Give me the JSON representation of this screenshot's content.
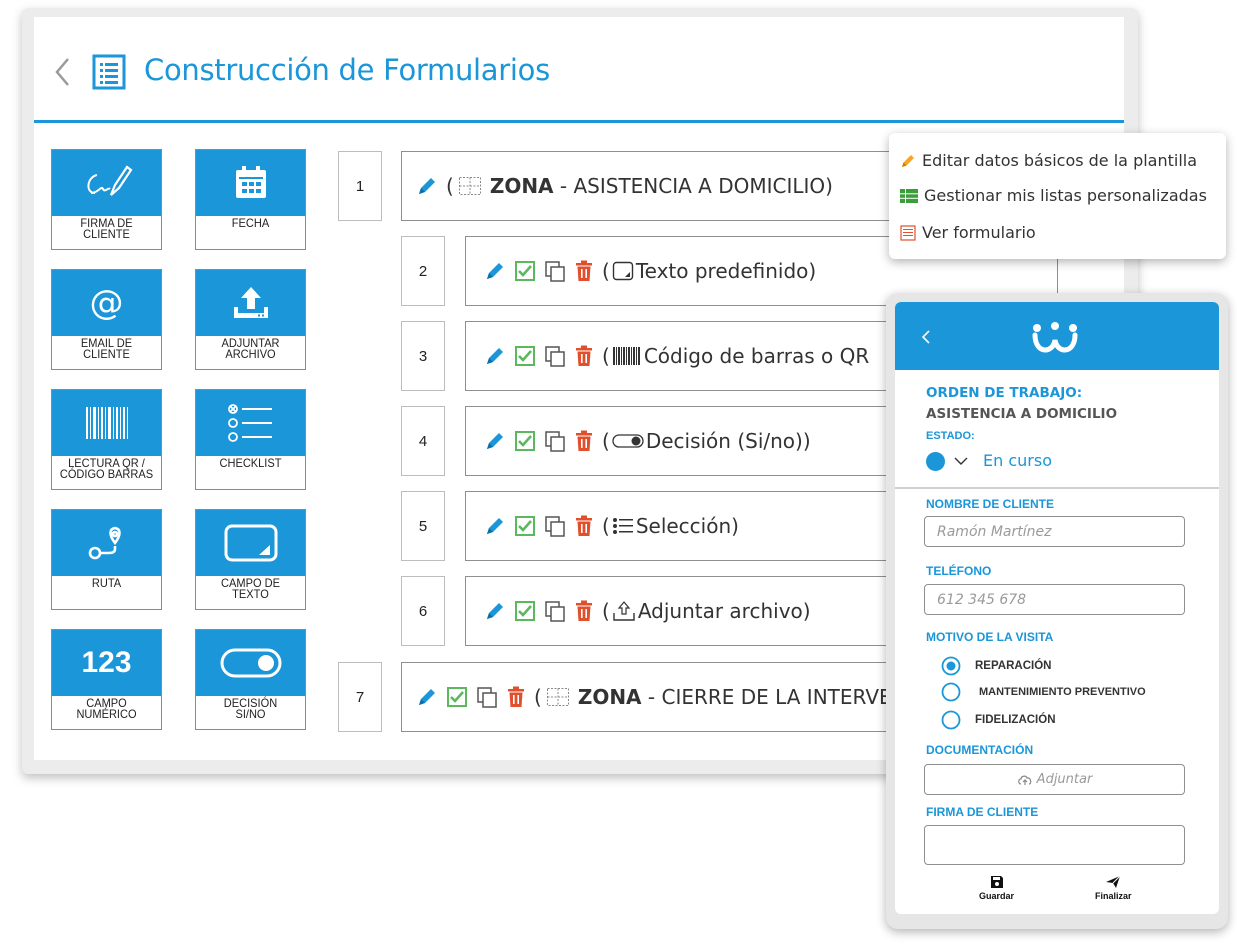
{
  "header": {
    "title": "Construcción de Formularios"
  },
  "palette": [
    {
      "id": "firma",
      "label_1": "FIRMA DE",
      "label_2": "CLIENTE",
      "icon": "signature-icon"
    },
    {
      "id": "fecha",
      "label_1": "FECHA",
      "label_2": "",
      "icon": "calendar-icon"
    },
    {
      "id": "email",
      "label_1": "EMAIL DE",
      "label_2": "CLIENTE",
      "icon": "at-icon"
    },
    {
      "id": "adjuntar",
      "label_1": "ADJUNTAR",
      "label_2": "ARCHIVO",
      "icon": "upload-icon"
    },
    {
      "id": "lectura",
      "label_1": "LECTURA QR /",
      "label_2": "CÓDIGO BARRAS",
      "icon": "barcode-icon"
    },
    {
      "id": "checklist",
      "label_1": "CHECKLIST",
      "label_2": "",
      "icon": "checklist-icon"
    },
    {
      "id": "ruta",
      "label_1": "RUTA",
      "label_2": "",
      "icon": "route-icon"
    },
    {
      "id": "campo-texto",
      "label_1": "CAMPO DE",
      "label_2": "TEXTO",
      "icon": "text-field-icon"
    },
    {
      "id": "campo-numerico",
      "label_1": "CAMPO",
      "label_2": "NUMÉRICO",
      "icon": "number-icon",
      "icon_text": "123"
    },
    {
      "id": "decision",
      "label_1": "DECISIÓN",
      "label_2": "SI/NO",
      "icon": "toggle-icon"
    }
  ],
  "rows": [
    {
      "index": "1",
      "prefix": "(",
      "bold": "ZONA",
      "text": " - ASISTENCIA A DOMICILIO)"
    },
    {
      "index": "2",
      "prefix": "(",
      "text": "Texto predefinido)"
    },
    {
      "index": "3",
      "prefix": "(",
      "text": "Código de barras o QR"
    },
    {
      "index": "4",
      "prefix": "(",
      "text": " Decisión (Si/no))"
    },
    {
      "index": "5",
      "prefix": "(",
      "text": "Selección)"
    },
    {
      "index": "6",
      "prefix": "(",
      "text": " Adjuntar archivo)"
    },
    {
      "index": "7",
      "prefix": "(",
      "bold": "ZONA",
      "text": " - CIERRE DE LA INTERVENCIÓN)"
    }
  ],
  "menu": {
    "items": [
      {
        "label": "Editar datos básicos de la plantilla",
        "icon": "pencil-icon"
      },
      {
        "label": "Gestionar mis listas personalizadas",
        "icon": "list-icon"
      },
      {
        "label": "Ver formulario",
        "icon": "form-icon"
      }
    ]
  },
  "phone": {
    "order_label": "ORDEN DE TRABAJO:",
    "order_name": "ASISTENCIA A DOMICILIO",
    "state_label": "ESTADO:",
    "state_value": "En curso",
    "client_label": "NOMBRE DE CLIENTE",
    "client_placeholder": "Ramón Martínez",
    "phone_label": "TELÉFONO",
    "phone_placeholder": "612 345 678",
    "reason_label": "MOTIVO DE LA VISITA",
    "reasons": [
      {
        "label": "REPARACIÓN",
        "selected": true
      },
      {
        "label": "MANTENIMIENTO PREVENTIVO",
        "selected": false
      },
      {
        "label": "FIDELIZACIÓN",
        "selected": false
      }
    ],
    "docs_label": "DOCUMENTACIÓN",
    "attach_label": "Adjuntar",
    "signature_label": "FIRMA DE CLIENTE",
    "save_label": "Guardar",
    "finish_label": "Finalizar"
  },
  "colors": {
    "accent": "#1a96d9",
    "check": "#5cb85c",
    "trash": "#e0502d"
  }
}
